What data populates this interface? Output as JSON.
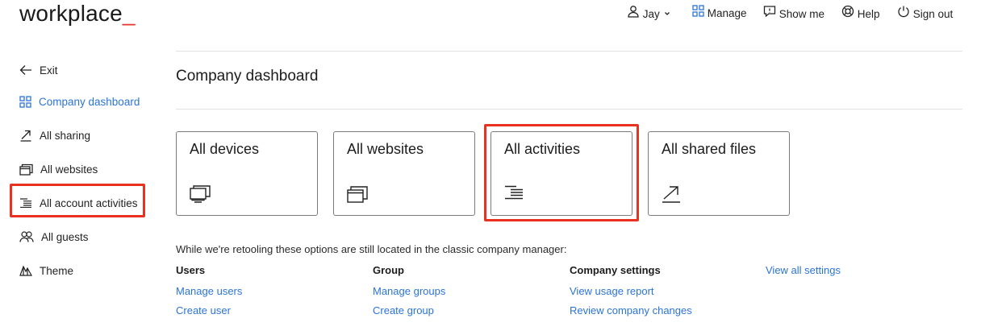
{
  "brand": {
    "logo_text": "workplace",
    "logo_accent": "_",
    "accent_color": "#e8352a"
  },
  "topnav": {
    "user_label": "Jay",
    "manage_label": "Manage",
    "show_me_label": "Show me",
    "help_label": "Help",
    "sign_out_label": "Sign out"
  },
  "sidebar": {
    "items": [
      {
        "label": "Exit",
        "icon": "arrow-left-icon"
      },
      {
        "label": "Company dashboard",
        "icon": "grid-icon",
        "active": true
      },
      {
        "label": "All sharing",
        "icon": "share-arrow-icon"
      },
      {
        "label": "All websites",
        "icon": "windows-icon"
      },
      {
        "label": "All account activities",
        "icon": "activity-lines-icon",
        "highlighted": true
      },
      {
        "label": "All guests",
        "icon": "guests-icon"
      },
      {
        "label": "Theme",
        "icon": "theme-icon"
      }
    ]
  },
  "main": {
    "title": "Company dashboard",
    "cards": [
      {
        "label": "All devices",
        "icon": "devices-icon"
      },
      {
        "label": "All websites",
        "icon": "windows-icon"
      },
      {
        "label": "All activities",
        "icon": "activity-lines-icon",
        "highlighted": true
      },
      {
        "label": "All shared files",
        "icon": "share-arrow-icon"
      }
    ],
    "note": "While we're retooling these options are still located in the classic company manager:",
    "columns": [
      {
        "heading": "Users",
        "links": [
          "Manage users",
          "Create user"
        ]
      },
      {
        "heading": "Group",
        "links": [
          "Manage groups",
          "Create group"
        ]
      },
      {
        "heading": "Company settings",
        "links": [
          "View usage report",
          "Review company changes"
        ]
      }
    ],
    "view_all_link": "View all settings"
  },
  "colors": {
    "link": "#2b74d6",
    "highlight": "#e8321f",
    "border": "#7b7b7b"
  }
}
